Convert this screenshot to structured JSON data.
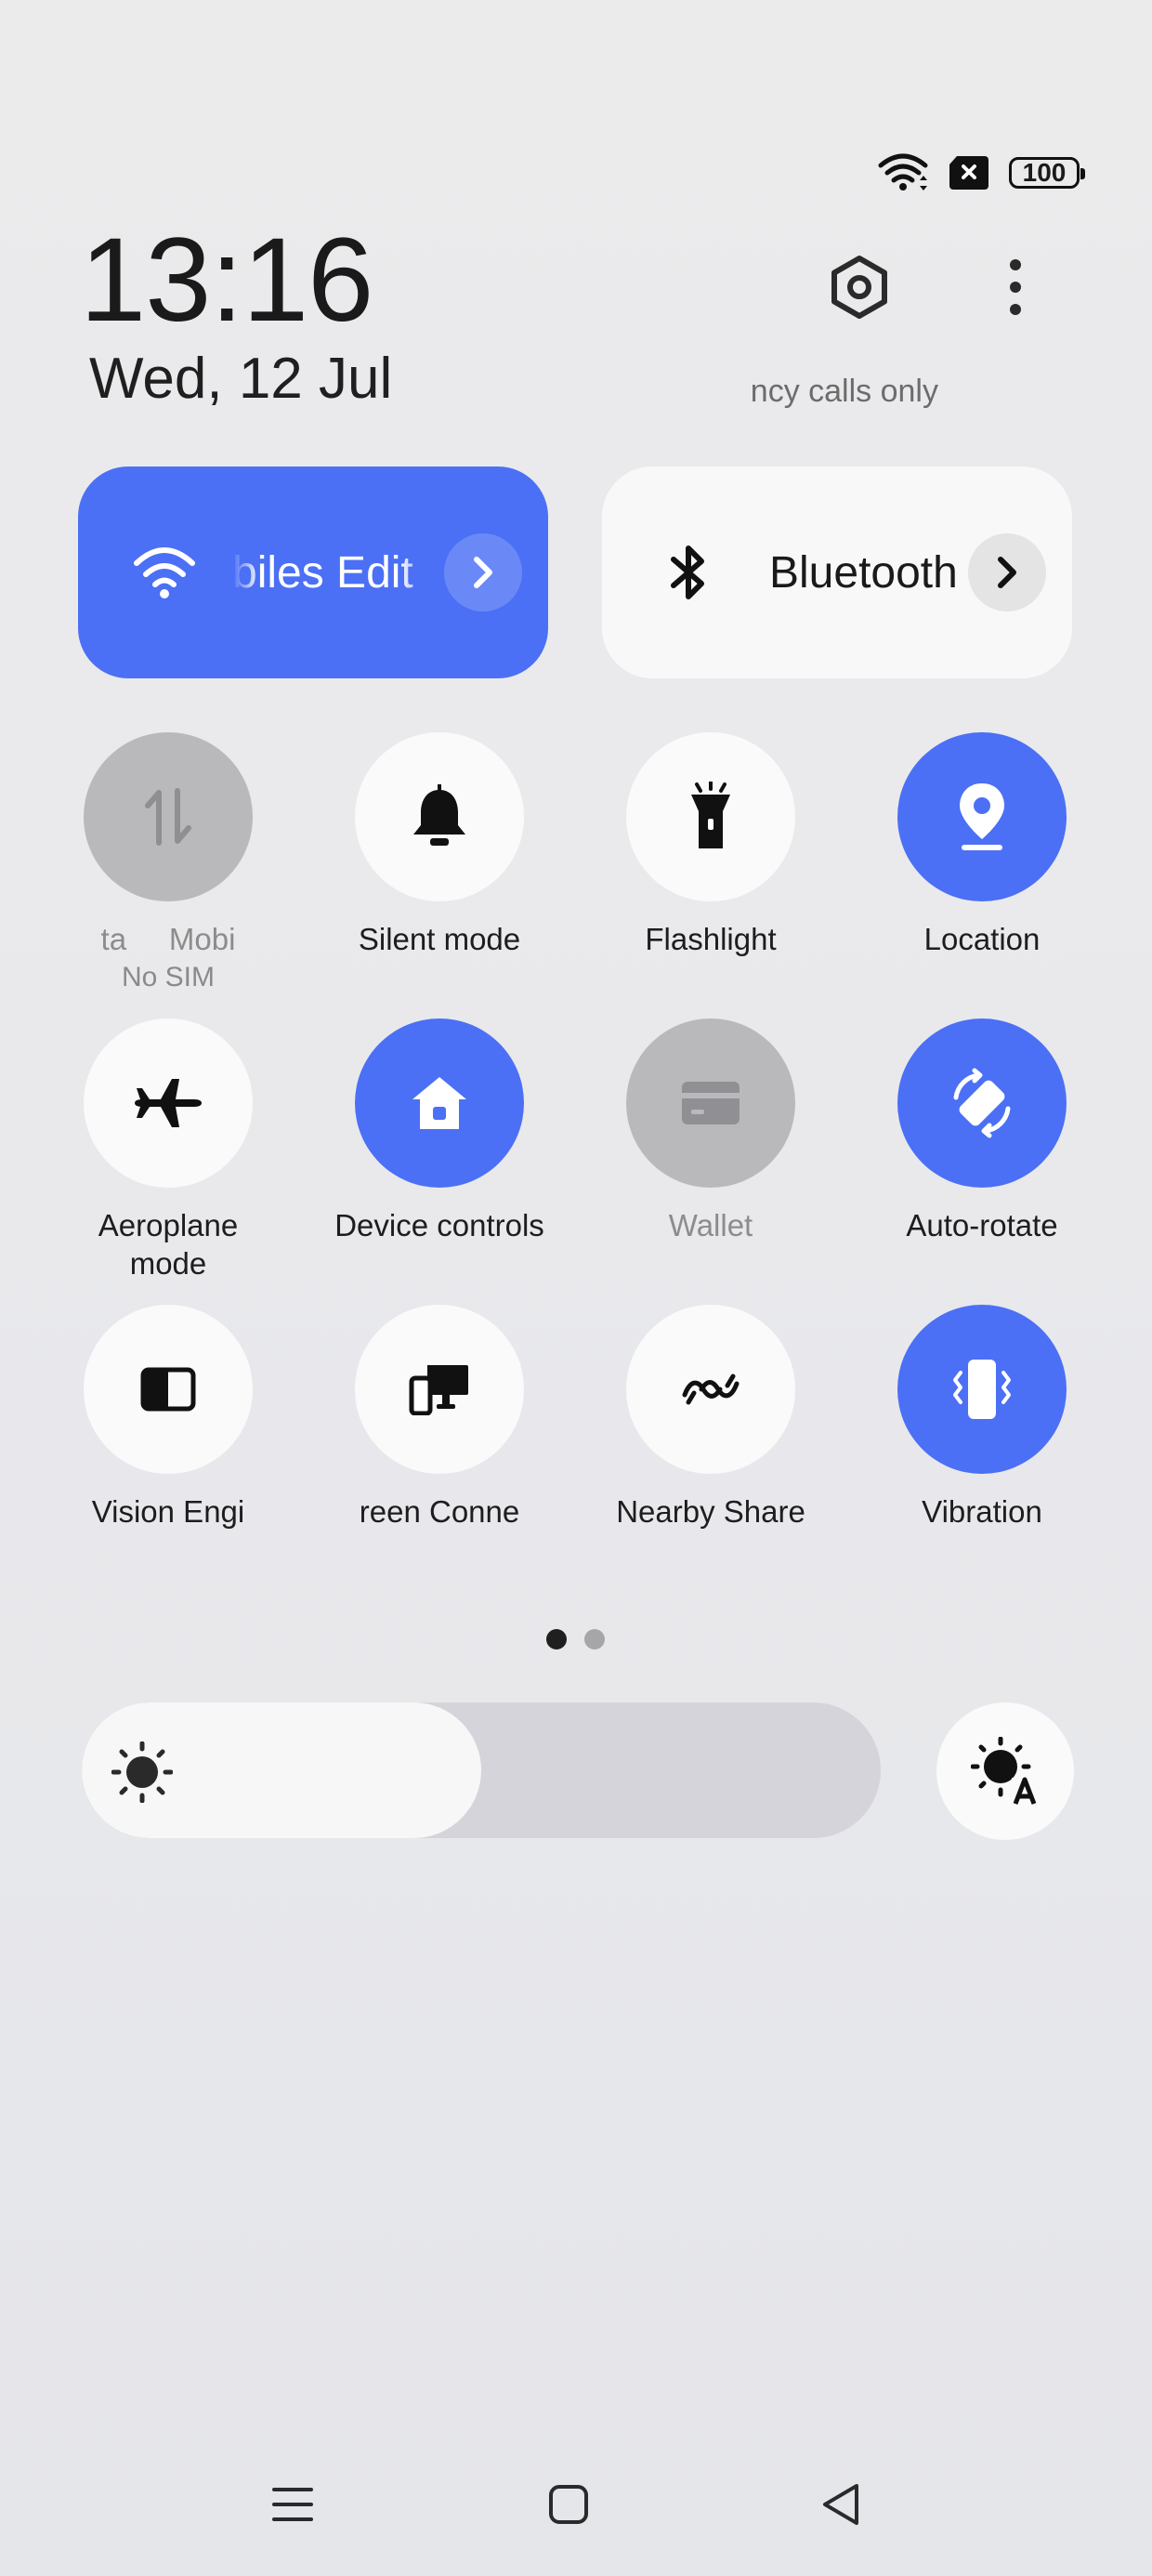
{
  "status_bar": {
    "battery_level": "100",
    "icons": [
      "wifi-icon",
      "no-sim-icon",
      "battery-icon"
    ]
  },
  "header": {
    "time": "13:16",
    "date": "Wed, 12 Jul",
    "carrier_status": "ncy calls only"
  },
  "wifi_tile": {
    "label": "biles Edit",
    "state": "on",
    "icon": "wifi-icon"
  },
  "bluetooth_tile": {
    "label": "Bluetooth",
    "state": "off",
    "icon": "bluetooth-icon"
  },
  "toggles": [
    {
      "label": "ta     Mobi",
      "sub": "No SIM",
      "state": "disabled",
      "icon": "mobile-data-icon"
    },
    {
      "label": "Silent mode",
      "state": "off",
      "icon": "bell-icon"
    },
    {
      "label": "Flashlight",
      "state": "off",
      "icon": "flashlight-icon"
    },
    {
      "label": "Location",
      "state": "on",
      "icon": "location-icon"
    },
    {
      "label": "Aeroplane mode",
      "state": "off",
      "icon": "airplane-icon"
    },
    {
      "label": "Device controls",
      "state": "on",
      "icon": "home-icon"
    },
    {
      "label": "Wallet",
      "state": "disabled",
      "icon": "wallet-icon"
    },
    {
      "label": "Auto-rotate",
      "state": "on",
      "icon": "auto-rotate-icon"
    },
    {
      "label": "Vision Engi",
      "state": "off",
      "icon": "vision-engine-icon"
    },
    {
      "label": "reen Conne",
      "state": "off",
      "icon": "screen-connect-icon"
    },
    {
      "label": "Nearby Share",
      "state": "off",
      "icon": "nearby-share-icon"
    },
    {
      "label": "Vibration",
      "state": "on",
      "icon": "vibration-icon"
    }
  ],
  "pager": {
    "current_page": 1,
    "page_count": 2
  },
  "brightness": {
    "level": 0.5,
    "auto_icon": "auto-brightness-icon"
  },
  "colors": {
    "accent": "#4b70f5",
    "tile_off": "#fafafa",
    "tile_disabled": "#b9b9bb"
  },
  "nav_bar": {
    "icons": [
      "menu-icon",
      "home-button-icon",
      "back-icon"
    ]
  }
}
